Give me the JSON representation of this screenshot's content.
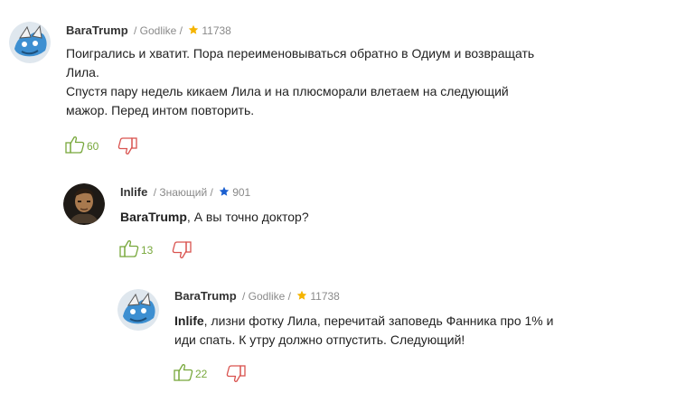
{
  "colors": {
    "like": "#78a83c",
    "dislike": "#d9534f",
    "star_gold": "#f5b400",
    "star_blue": "#1a5fd0"
  },
  "comments": [
    {
      "author": "BaraTrump",
      "rank": "/ Godlike /",
      "rating": "11738",
      "star_icon": "star-gold-icon",
      "lines": [
        "Поигрались и хватит. Пора переименовываться обратно в Одиум и возвращать",
        "Лила.",
        "Спустя пару недель кикаем Лила и на плюсморали влетаем на следующий",
        "мажор. Перед интом повторить."
      ],
      "likes": "60"
    },
    {
      "author": "Inlife",
      "rank": "/ Знающий /",
      "rating": "901",
      "star_icon": "star-blue-icon",
      "mention": "BaraTrump",
      "lines": [
        ", А вы точно доктор?"
      ],
      "likes": "13"
    },
    {
      "author": "BaraTrump",
      "rank": "/ Godlike /",
      "rating": "11738",
      "star_icon": "star-gold-icon",
      "mention": "Inlife",
      "lines": [
        ", лизни фотку Лила, перечитай заповедь Фанника про 1% и",
        "иди спать. К утру должно отпустить. Следующий!"
      ],
      "likes": "22"
    }
  ]
}
